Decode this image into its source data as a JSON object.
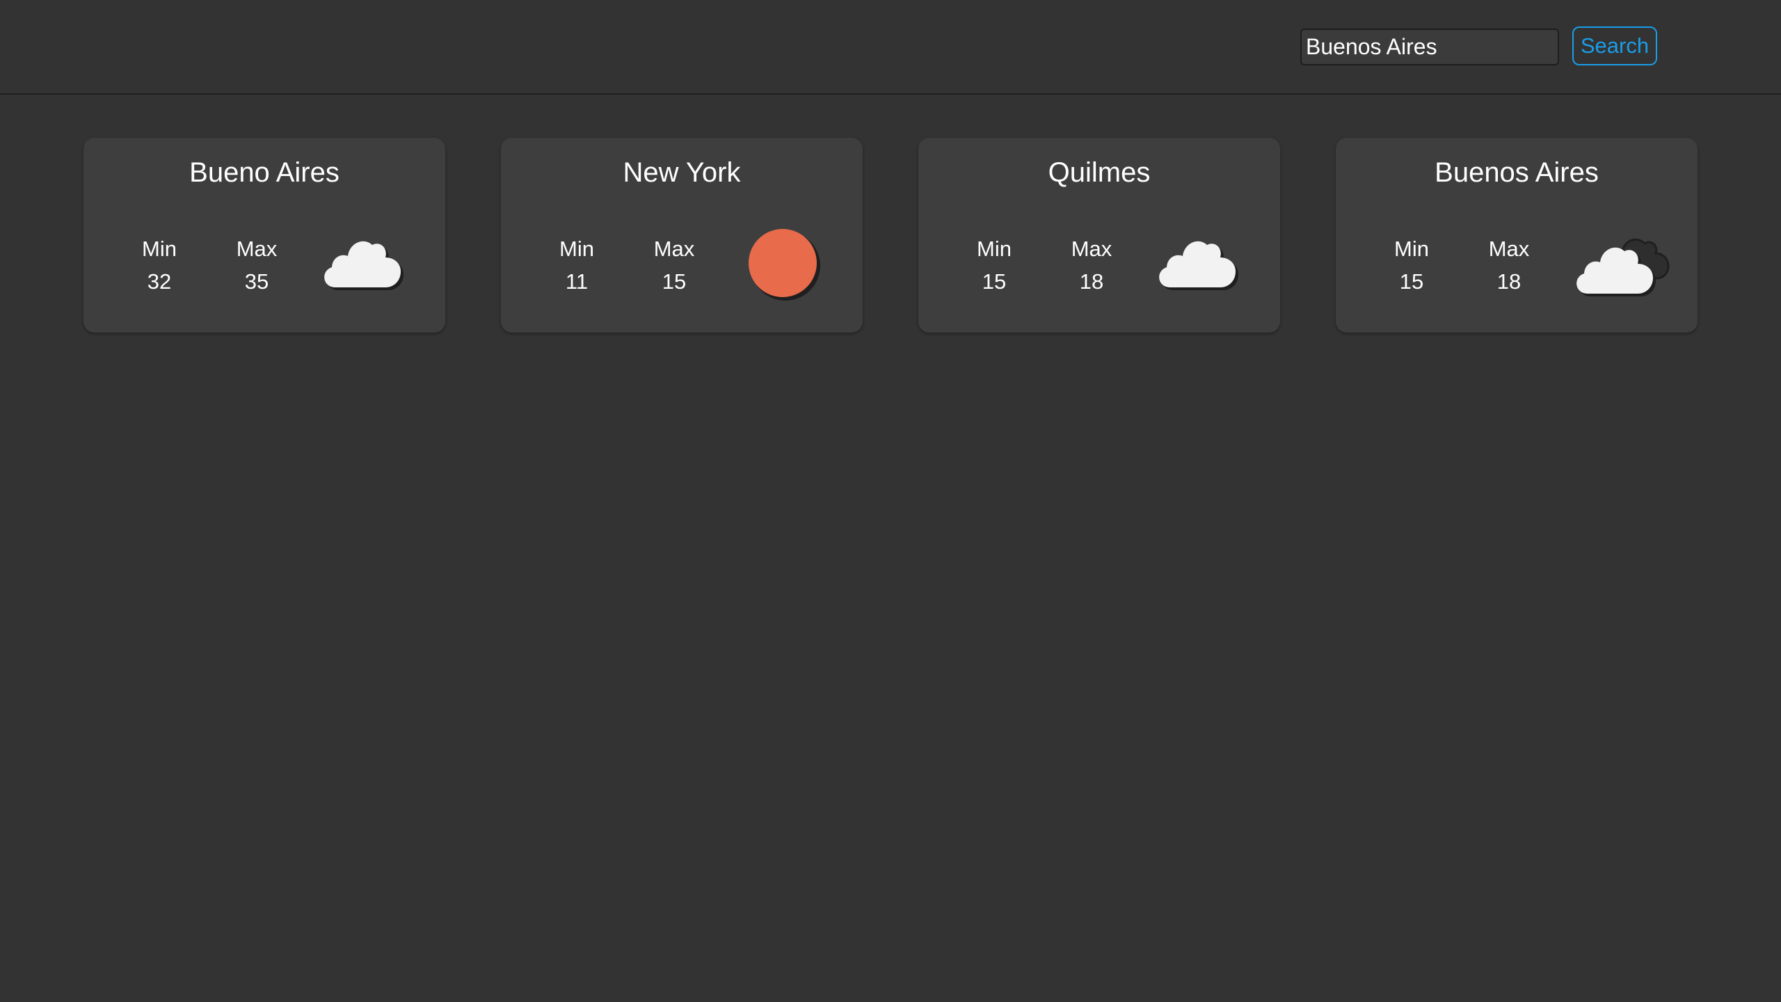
{
  "search": {
    "value": "Buenos Aires",
    "button_label": "Search"
  },
  "cards": [
    {
      "city": "Bueno Aires",
      "min_label": "Min",
      "min": "32",
      "max_label": "Max",
      "max": "35",
      "icon": "cloud-icon"
    },
    {
      "city": "New York",
      "min_label": "Min",
      "min": "11",
      "max_label": "Max",
      "max": "15",
      "icon": "sun-icon"
    },
    {
      "city": "Quilmes",
      "min_label": "Min",
      "min": "15",
      "max_label": "Max",
      "max": "18",
      "icon": "cloud-icon"
    },
    {
      "city": "Buenos Aires",
      "min_label": "Min",
      "min": "15",
      "max_label": "Max",
      "max": "18",
      "icon": "clouds-icon"
    }
  ],
  "colors": {
    "background": "#333333",
    "card": "#3e3e3e",
    "accent": "#1a9de8",
    "sun": "#e86b4c",
    "cloud": "#f2f2f2"
  }
}
